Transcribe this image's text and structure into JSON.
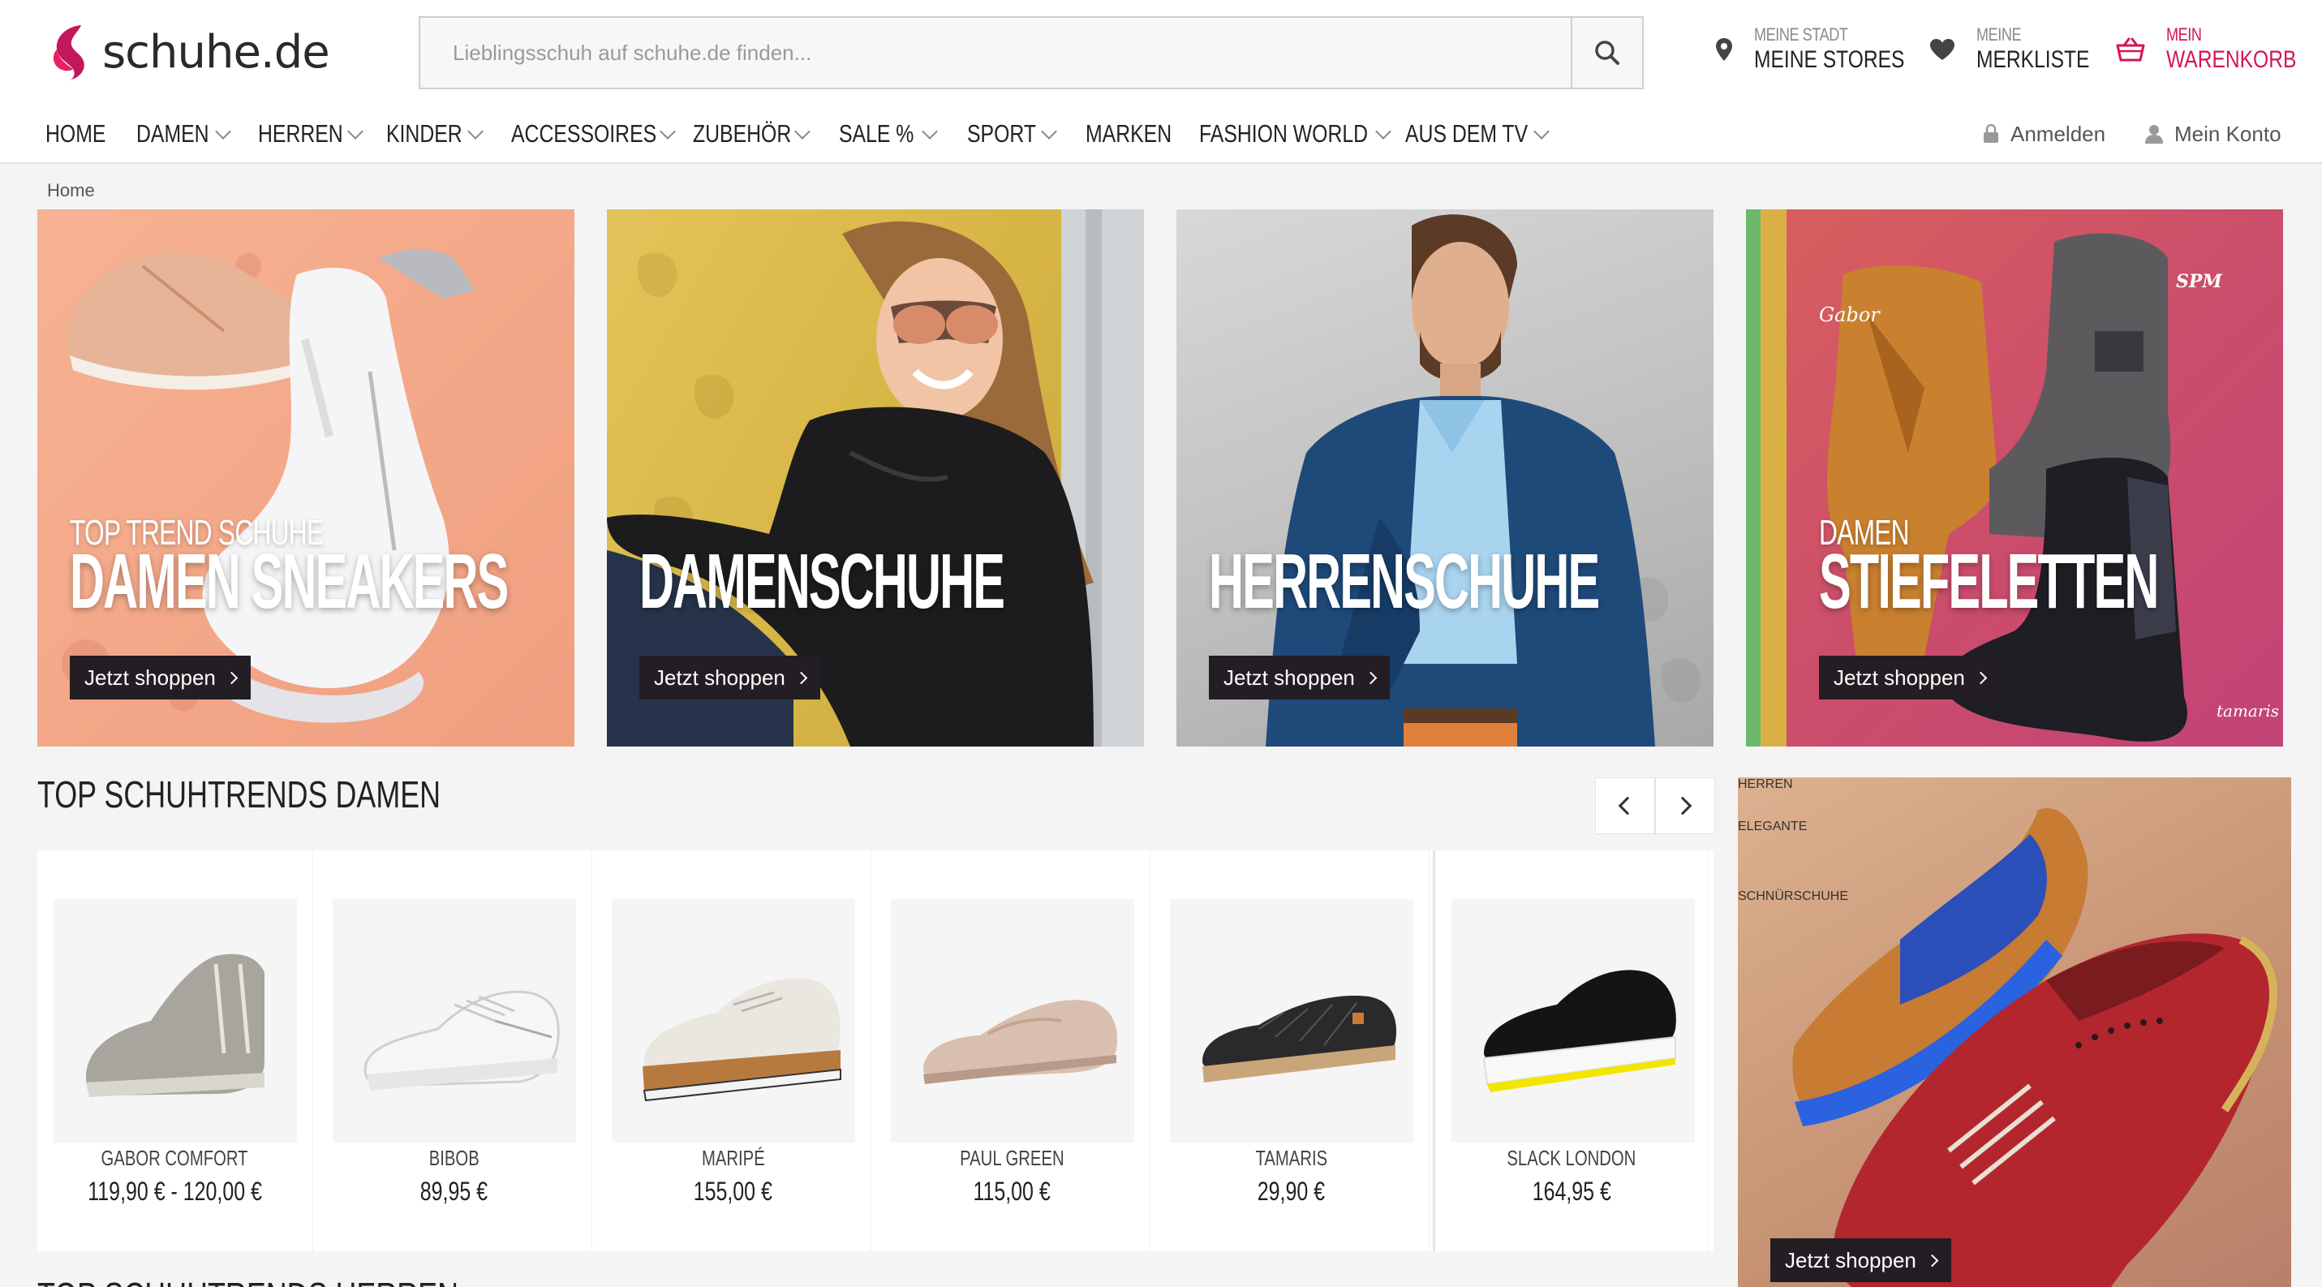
{
  "header": {
    "logo_text": "schuhe.de",
    "search_placeholder": "Lieblingsschuh auf schuhe.de finden...",
    "stores": {
      "small": "MEINE STADT",
      "big": "MEINE STORES"
    },
    "wishlist": {
      "small": "MEINE",
      "big": "MERKLISTE"
    },
    "cart": {
      "small": "MEIN",
      "big": "WARENKORB"
    },
    "brand_color": "#d4145a"
  },
  "nav": {
    "items": [
      {
        "label": "HOME",
        "has_dropdown": false
      },
      {
        "label": "DAMEN",
        "has_dropdown": true
      },
      {
        "label": "HERREN",
        "has_dropdown": true
      },
      {
        "label": "KINDER",
        "has_dropdown": true
      },
      {
        "label": "ACCESSOIRES",
        "has_dropdown": true
      },
      {
        "label": "ZUBEHÖR",
        "has_dropdown": true
      },
      {
        "label": "SALE %",
        "has_dropdown": true
      },
      {
        "label": "SPORT",
        "has_dropdown": true
      },
      {
        "label": "MARKEN",
        "has_dropdown": false
      },
      {
        "label": "FASHION WORLD",
        "has_dropdown": true
      },
      {
        "label": "AUS DEM TV",
        "has_dropdown": true
      }
    ],
    "login_label": "Anmelden",
    "account_label": "Mein Konto"
  },
  "breadcrumb": "Home",
  "banners": [
    {
      "subtitle": "TOP TREND SCHUHE",
      "title": "DAMEN SNEAKERS",
      "cta": "Jetzt shoppen"
    },
    {
      "subtitle": "",
      "title": "DAMENSCHUHE",
      "cta": "Jetzt shoppen"
    },
    {
      "subtitle": "",
      "title": "HERRENSCHUHE",
      "cta": "Jetzt shoppen"
    },
    {
      "subtitle": "DAMEN",
      "title": "STIEFELETTEN",
      "cta": "Jetzt shoppen",
      "logos": [
        "Gabor",
        "SPM",
        "tamaris"
      ]
    }
  ],
  "trends": {
    "title": "TOP SCHUHTRENDS DAMEN",
    "products": [
      {
        "brand": "GABOR COMFORT",
        "price": "119,90 € - 120,00 €"
      },
      {
        "brand": "BIBOB",
        "price": "89,95 €"
      },
      {
        "brand": "MARIPÉ",
        "price": "155,00 €"
      },
      {
        "brand": "PAUL GREEN",
        "price": "115,00 €"
      },
      {
        "brand": "TAMARIS",
        "price": "29,90 €"
      },
      {
        "brand": "SLACK LONDON",
        "price": "164,95 €"
      }
    ]
  },
  "side_banner": {
    "subtitle": "HERREN",
    "title_line1": "ELEGANTE",
    "title_line2": "SCHNÜRSCHUHE",
    "cta": "Jetzt shoppen"
  },
  "next_section_title": "TOP SCHUHTRENDS HERREN"
}
